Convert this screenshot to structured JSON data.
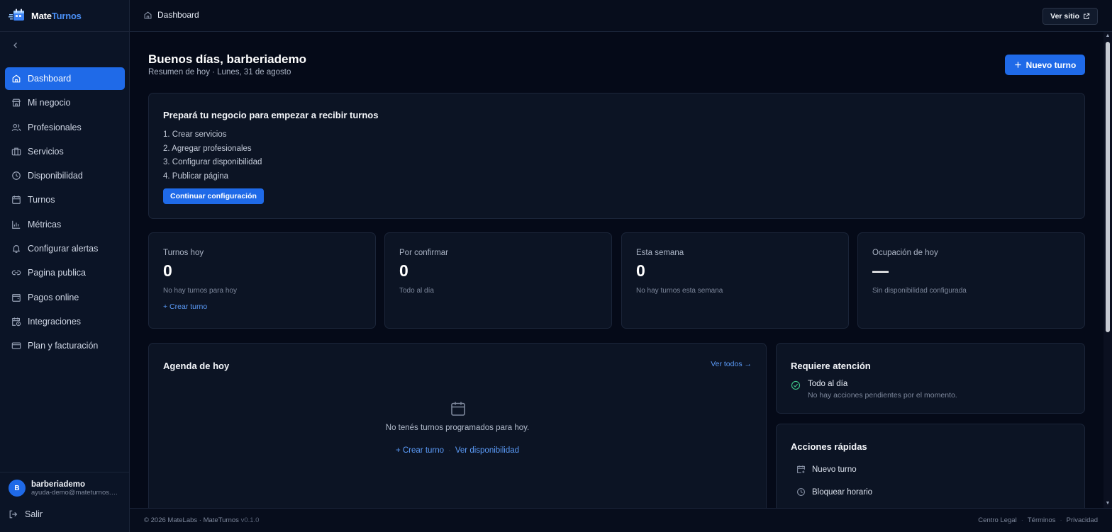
{
  "app": {
    "brand_part1": "Mate",
    "brand_part2": "Turnos"
  },
  "sidebar": {
    "items": [
      {
        "label": "Dashboard",
        "icon": "home-icon",
        "active": true
      },
      {
        "label": "Mi negocio",
        "icon": "store-icon"
      },
      {
        "label": "Profesionales",
        "icon": "users-icon"
      },
      {
        "label": "Servicios",
        "icon": "briefcase-icon"
      },
      {
        "label": "Disponibilidad",
        "icon": "clock-icon"
      },
      {
        "label": "Turnos",
        "icon": "calendar-icon"
      },
      {
        "label": "Métricas",
        "icon": "bar-chart-icon"
      },
      {
        "label": "Configurar alertas",
        "icon": "bell-icon"
      },
      {
        "label": "Pagina publica",
        "icon": "link-icon"
      },
      {
        "label": "Pagos online",
        "icon": "wallet-icon"
      },
      {
        "label": "Integraciones",
        "icon": "calendar-clock-icon"
      },
      {
        "label": "Plan y facturación",
        "icon": "credit-card-icon"
      }
    ],
    "user": {
      "initial": "B",
      "name": "barberiademo",
      "email": "ayuda-demo@mateturnos.com"
    },
    "logout_label": "Salir"
  },
  "topbar": {
    "breadcrumb": "Dashboard",
    "ver_sitio": "Ver sitio"
  },
  "main": {
    "greeting": "Buenos días, barberiademo",
    "subtitle": "Resumen de hoy · Lunes, 31 de agosto",
    "new_turn_label": "Nuevo turno",
    "setup": {
      "title": "Prepará tu negocio para empezar a recibir turnos",
      "steps": [
        "1. Crear servicios",
        "2. Agregar profesionales",
        "3. Configurar disponibilidad",
        "4. Publicar página"
      ],
      "cta": "Continuar configuración"
    },
    "stats": [
      {
        "label": "Turnos hoy",
        "value": "0",
        "note": "No hay turnos para hoy",
        "link": "+ Crear turno"
      },
      {
        "label": "Por confirmar",
        "value": "0",
        "note": "Todo al día"
      },
      {
        "label": "Esta semana",
        "value": "0",
        "note": "No hay turnos esta semana"
      },
      {
        "label": "Ocupación de hoy",
        "value": "—",
        "note": "Sin disponibilidad configurada"
      }
    ],
    "agenda": {
      "title": "Agenda de hoy",
      "ver_todos": "Ver todos",
      "empty": "No tenés turnos programados para hoy.",
      "link_create": "+ Crear turno",
      "link_dot": "·",
      "link_availability": "Ver disponibilidad"
    },
    "attention": {
      "title": "Requiere atención",
      "status": "Todo al día",
      "detail": "No hay acciones pendientes por el momento."
    },
    "quick_actions": {
      "title": "Acciones rápidas",
      "items": [
        {
          "label": "Nuevo turno",
          "icon": "calendar-plus-icon"
        },
        {
          "label": "Bloquear horario",
          "icon": "clock-icon"
        }
      ]
    }
  },
  "footer": {
    "copyright": "© 2026 MateLabs · MateTurnos",
    "version": "v0.1.0",
    "links": [
      "Centro Legal",
      "Términos",
      "Privacidad"
    ],
    "separator": "·"
  },
  "colors": {
    "accent": "#1f6ae8",
    "link": "#5b9bf8",
    "background": "#050a18",
    "card": "#0c1424",
    "success": "#3ec98a"
  }
}
